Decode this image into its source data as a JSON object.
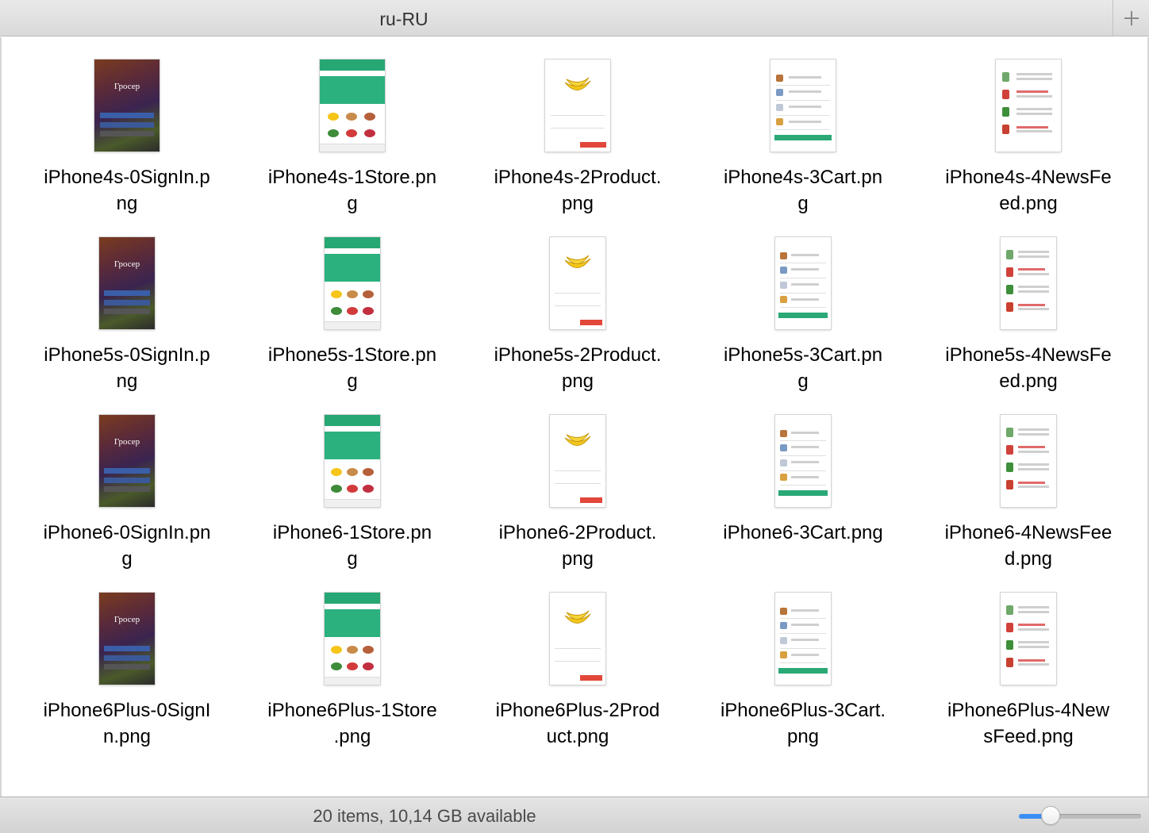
{
  "window": {
    "title": "ru-RU",
    "add_icon": "plus-icon"
  },
  "files": [
    {
      "lines": [
        "iPhone4s-0SignIn.p",
        "ng"
      ],
      "device": "4s",
      "kind": "signin"
    },
    {
      "lines": [
        "iPhone4s-1Store.pn",
        "g"
      ],
      "device": "4s",
      "kind": "store"
    },
    {
      "lines": [
        "iPhone4s-2Product.",
        "png"
      ],
      "device": "4s",
      "kind": "product"
    },
    {
      "lines": [
        "iPhone4s-3Cart.pn",
        "g"
      ],
      "device": "4s",
      "kind": "cart"
    },
    {
      "lines": [
        "iPhone4s-4NewsFe",
        "ed.png"
      ],
      "device": "4s",
      "kind": "news"
    },
    {
      "lines": [
        "iPhone5s-0SignIn.p",
        "ng"
      ],
      "device": "5s",
      "kind": "signin"
    },
    {
      "lines": [
        "iPhone5s-1Store.pn",
        "g"
      ],
      "device": "5s",
      "kind": "store"
    },
    {
      "lines": [
        "iPhone5s-2Product.",
        "png"
      ],
      "device": "5s",
      "kind": "product"
    },
    {
      "lines": [
        "iPhone5s-3Cart.pn",
        "g"
      ],
      "device": "5s",
      "kind": "cart"
    },
    {
      "lines": [
        "iPhone5s-4NewsFe",
        "ed.png"
      ],
      "device": "5s",
      "kind": "news"
    },
    {
      "lines": [
        "iPhone6-0SignIn.pn",
        "g"
      ],
      "device": "6",
      "kind": "signin"
    },
    {
      "lines": [
        "iPhone6-1Store.pn",
        "g"
      ],
      "device": "6",
      "kind": "store"
    },
    {
      "lines": [
        "iPhone6-2Product.",
        "png"
      ],
      "device": "6",
      "kind": "product"
    },
    {
      "lines": [
        "iPhone6-3Cart.png"
      ],
      "device": "6",
      "kind": "cart"
    },
    {
      "lines": [
        "iPhone6-4NewsFee",
        "d.png"
      ],
      "device": "6",
      "kind": "news"
    },
    {
      "lines": [
        "iPhone6Plus-0SignI",
        "n.png"
      ],
      "device": "6p",
      "kind": "signin"
    },
    {
      "lines": [
        "iPhone6Plus-1Store",
        ".png"
      ],
      "device": "6p",
      "kind": "store"
    },
    {
      "lines": [
        "iPhone6Plus-2Prod",
        "uct.png"
      ],
      "device": "6p",
      "kind": "product"
    },
    {
      "lines": [
        "iPhone6Plus-3Cart.",
        "png"
      ],
      "device": "6p",
      "kind": "cart"
    },
    {
      "lines": [
        "iPhone6Plus-4New",
        "sFeed.png"
      ],
      "device": "6p",
      "kind": "news"
    }
  ],
  "thumbnail_text": {
    "signin_brand": "Гросер"
  },
  "status": {
    "text": "20 items, 10,14 GB available",
    "zoom_level": 0.26
  },
  "colors": {
    "accent": "#3a8ef5",
    "store_green": "#26a774",
    "product_red": "#e2473a"
  }
}
